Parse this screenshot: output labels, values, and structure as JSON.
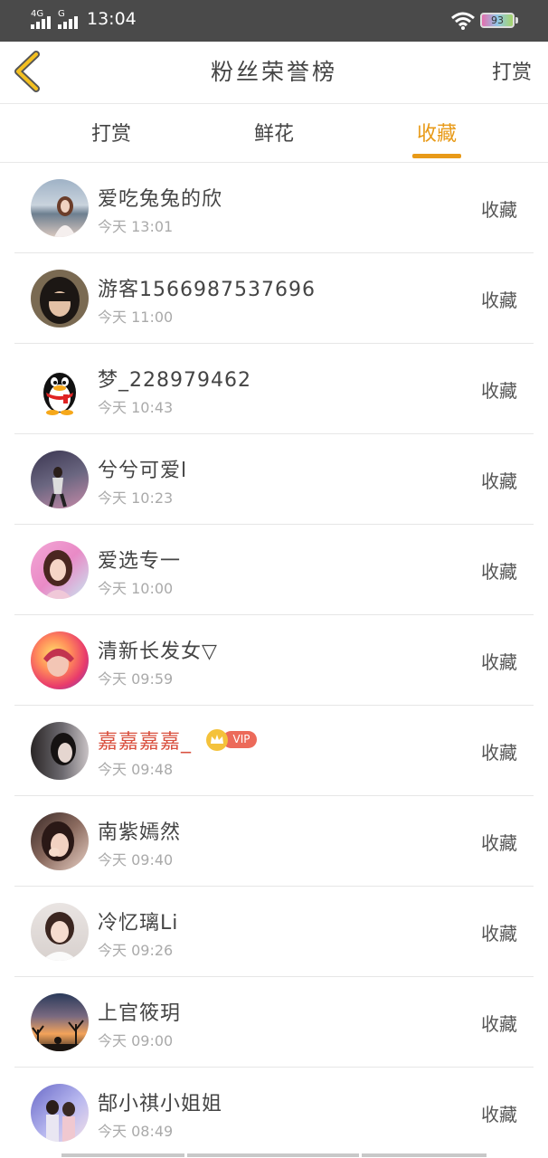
{
  "status": {
    "network1": "4G",
    "network2": "G",
    "time": "13:04",
    "battery": "93"
  },
  "nav": {
    "title": "粉丝荣誉榜",
    "action": "打赏"
  },
  "tabs": [
    {
      "label": "打赏"
    },
    {
      "label": "鲜花"
    },
    {
      "label": "收藏",
      "active": true
    }
  ],
  "accent_color": "#e89a18",
  "vip_label": "VIP",
  "rows": [
    {
      "name": "爱吃兔兔的欣",
      "time": "今天 13:01",
      "action": "收藏",
      "avatar": "photo",
      "vip": false
    },
    {
      "name": "游客1566987537696",
      "time": "今天 11:00",
      "action": "收藏",
      "avatar": "photo",
      "vip": false
    },
    {
      "name": "梦_228979462",
      "time": "今天 10:43",
      "action": "收藏",
      "avatar": "penguin-icon",
      "vip": false
    },
    {
      "name": "兮兮可爱l",
      "time": "今天 10:23",
      "action": "收藏",
      "avatar": "photo",
      "vip": false
    },
    {
      "name": "爱选专一",
      "time": "今天 10:00",
      "action": "收藏",
      "avatar": "photo",
      "vip": false
    },
    {
      "name": "清新长发女▽",
      "time": "今天 09:59",
      "action": "收藏",
      "avatar": "photo",
      "vip": false
    },
    {
      "name": "嘉嘉嘉嘉_",
      "time": "今天 09:48",
      "action": "收藏",
      "avatar": "photo",
      "vip": true
    },
    {
      "name": "南紫嫣然",
      "time": "今天 09:40",
      "action": "收藏",
      "avatar": "photo",
      "vip": false
    },
    {
      "name": "冷忆璃Li",
      "time": "今天 09:26",
      "action": "收藏",
      "avatar": "photo",
      "vip": false
    },
    {
      "name": "上官筱玥",
      "time": "今天 09:00",
      "action": "收藏",
      "avatar": "photo",
      "vip": false
    },
    {
      "name": "郜小祺小姐姐",
      "time": "今天 08:49",
      "action": "收藏",
      "avatar": "photo",
      "vip": false
    }
  ]
}
